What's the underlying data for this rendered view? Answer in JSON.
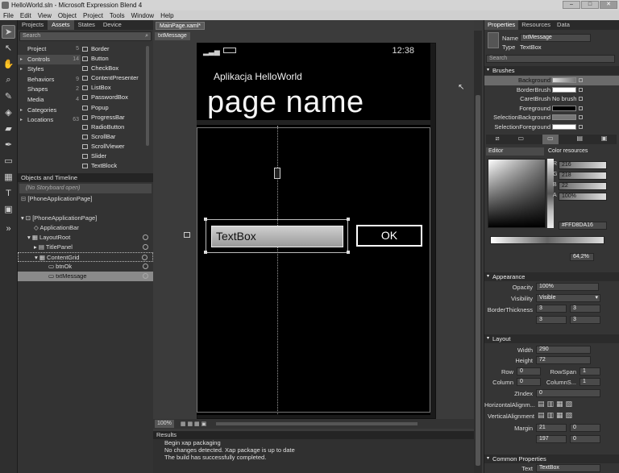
{
  "window": {
    "title": "HelloWorld.sln - Microsoft Expression Blend 4"
  },
  "menu": [
    "File",
    "Edit",
    "View",
    "Object",
    "Project",
    "Tools",
    "Window",
    "Help"
  ],
  "left_panel": {
    "tabs": [
      "Projects",
      "Assets",
      "States",
      "Device"
    ],
    "search_placeholder": "Search",
    "categories": [
      {
        "label": "Project",
        "count": "5"
      },
      {
        "label": "Controls",
        "count": "14"
      },
      {
        "label": "Styles",
        "count": ""
      },
      {
        "label": "Behaviors",
        "count": "9"
      },
      {
        "label": "Shapes",
        "count": "2"
      },
      {
        "label": "Media",
        "count": "4"
      },
      {
        "label": "Categories",
        "count": ""
      },
      {
        "label": "Locations",
        "count": "63"
      }
    ],
    "controls": [
      "Border",
      "Button",
      "CheckBox",
      "ContentPresenter",
      "ListBox",
      "PasswordBox",
      "Popup",
      "ProgressBar",
      "RadioButton",
      "ScrollBar",
      "ScrollViewer",
      "Slider",
      "TextBlock"
    ]
  },
  "objects_timeline": {
    "title": "Objects and Timeline",
    "storyboard": "(No Storyboard open)",
    "root": "[PhoneApplicationPage]",
    "tree": [
      {
        "label": "[PhoneApplicationPage]",
        "indent": 2
      },
      {
        "label": "ApplicationBar",
        "indent": 3
      },
      {
        "label": "LayoutRoot",
        "indent": 2
      },
      {
        "label": "TitlePanel",
        "indent": 3
      },
      {
        "label": "ContentGrid",
        "indent": 3
      },
      {
        "label": "btnOk",
        "indent": 4
      },
      {
        "label": "txtMessage",
        "indent": 4
      }
    ]
  },
  "document": {
    "tab": "MainPage.xaml*",
    "breadcrumb": "txtMessage",
    "status_time": "12:38",
    "app_title": "Aplikacja HelloWorld",
    "page_name": "page name",
    "textbox_text": "TextBox",
    "button_text": "OK",
    "zoom": "100%"
  },
  "results": {
    "title": "Results",
    "lines": [
      "Begin xap packaging",
      "No changes detected. Xap package is up to date",
      "The build has successfully completed."
    ]
  },
  "right_panel": {
    "tabs": [
      "Properties",
      "Resources",
      "Data"
    ],
    "name_label": "Name",
    "name_value": "txtMessage",
    "type_label": "Type",
    "type_value": "TextBox",
    "search_placeholder": "Search",
    "brushes_title": "Brushes",
    "brushes": [
      {
        "label": "Background",
        "value": ""
      },
      {
        "label": "BorderBrush",
        "value": ""
      },
      {
        "label": "CaretBrush",
        "value": "No brush"
      },
      {
        "label": "Foreground",
        "value": ""
      },
      {
        "label": "SelectionBackground",
        "value": ""
      },
      {
        "label": "SelectionForeground",
        "value": ""
      }
    ],
    "editor_label": "Editor",
    "color_resources_label": "Color resources",
    "rgba": {
      "R": "216",
      "G": "218",
      "B": "22",
      "A": "100%"
    },
    "hex": "#FFD8DA16",
    "gradient_offset": "64,2%",
    "appearance_title": "Appearance",
    "opacity_label": "Opacity",
    "opacity": "100%",
    "visibility_label": "Visibility",
    "visibility": "Visible",
    "border_thickness_label": "BorderThickness",
    "thickness": [
      "3",
      "3",
      "3",
      "3"
    ],
    "layout_title": "Layout",
    "width_label": "Width",
    "width": "290",
    "height_label": "Height",
    "height": "72",
    "row_label": "Row",
    "row": "0",
    "rowspan_label": "RowSpan",
    "rowspan": "1",
    "column_label": "Column",
    "column": "0",
    "columnspan_label": "ColumnS...",
    "columnspan": "1",
    "zindex_label": "ZIndex",
    "zindex": "0",
    "halign_label": "HorizontalAlignm...",
    "valign_label": "VerticalAlignment",
    "margin_label": "Margin",
    "margin": [
      "21",
      "0",
      "197",
      "0"
    ],
    "common_title": "Common Properties",
    "text_label": "Text",
    "text_value": "TextBox"
  }
}
